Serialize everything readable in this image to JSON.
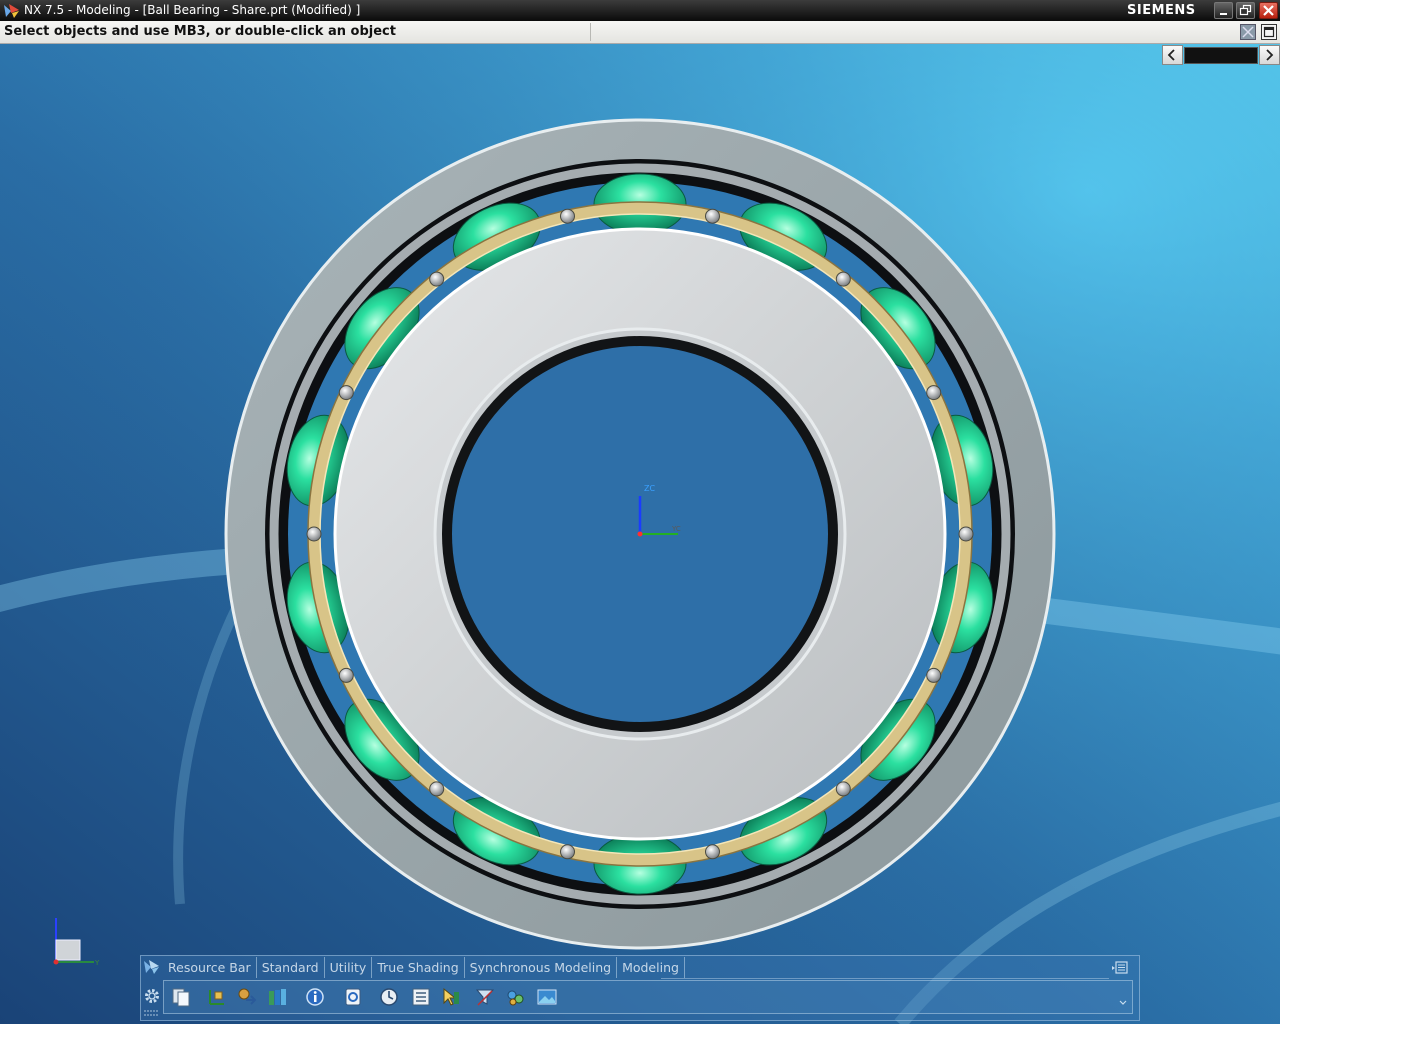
{
  "window": {
    "title": "NX 7.5 - Modeling - [Ball Bearing - Share.prt (Modified) ]",
    "brand": "SIEMENS",
    "controls": [
      "minimize-icon",
      "restore-icon",
      "close-icon"
    ]
  },
  "cue_line": {
    "text": "Select objects and use MB3, or double-click an object"
  },
  "viewport": {
    "model": "ball bearing",
    "view_triad_labels": {
      "z": "ZC",
      "y": "YC"
    },
    "corner_triad_labels": {
      "y": "Y"
    },
    "colors": {
      "background_dark": "#1d4f86",
      "background_light": "#4cc4ec",
      "rings": "#c4c8ca",
      "outer_ring": "#98a4a8",
      "balls": "#1fc48c",
      "cage": "#d6c080"
    }
  },
  "toolbar_dock": {
    "tabs": [
      "Resource Bar",
      "Standard",
      "Utility",
      "True Shading",
      "Synchronous Modeling",
      "Modeling"
    ],
    "tools": [
      "copy-icon",
      "transform-icon",
      "move-icon",
      "layer-icon",
      "info-icon",
      "analysis-icon",
      "clock-icon",
      "list-icon",
      "cursor-icon",
      "filter-icon",
      "group-icon",
      "image-icon"
    ]
  }
}
